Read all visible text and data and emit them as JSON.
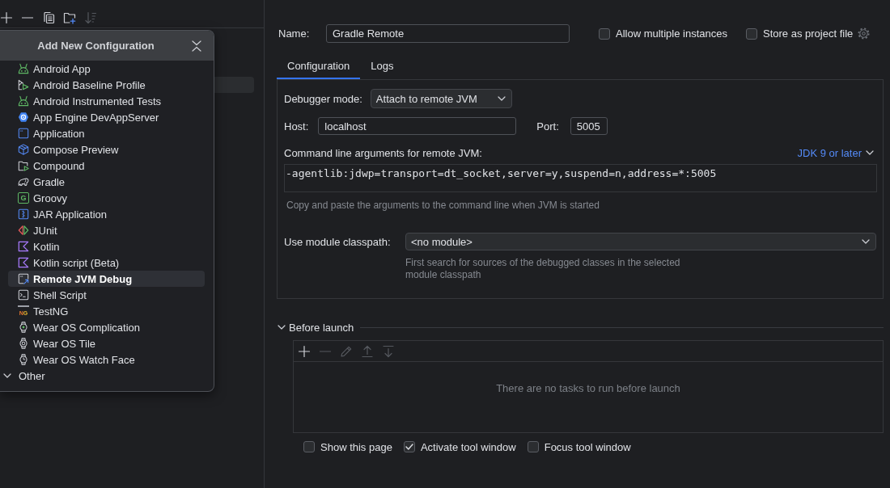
{
  "toolbar": [
    {
      "disabled": false
    },
    {
      "disabled": false
    },
    {
      "disabled": false
    },
    {
      "disabled": false
    },
    {
      "disabled": true
    }
  ],
  "popup": {
    "title": "Add New Configuration",
    "items": [
      {
        "label": "Android App",
        "selected": false
      },
      {
        "label": "Android Baseline Profile",
        "selected": false
      },
      {
        "label": "Android Instrumented Tests",
        "selected": false
      },
      {
        "label": "App Engine DevAppServer",
        "selected": false
      },
      {
        "label": "Application",
        "selected": false
      },
      {
        "label": "Compose Preview",
        "selected": false
      },
      {
        "label": "Compound",
        "selected": false
      },
      {
        "label": "Gradle",
        "selected": false
      },
      {
        "label": "Groovy",
        "icon_text": "G",
        "selected": false
      },
      {
        "label": "JAR Application",
        "selected": false
      },
      {
        "label": "JUnit",
        "selected": false
      },
      {
        "label": "Kotlin",
        "selected": false
      },
      {
        "label": "Kotlin script (Beta)",
        "selected": false
      },
      {
        "label": "Remote JVM Debug",
        "selected": true
      },
      {
        "label": "Shell Script",
        "selected": false
      },
      {
        "label": "TestNG",
        "icon_text": "NG",
        "selected": false
      },
      {
        "label": "Wear OS Complication",
        "selected": false
      },
      {
        "label": "Wear OS Tile",
        "selected": false
      },
      {
        "label": "Wear OS Watch Face",
        "selected": false
      }
    ],
    "other_group": {
      "label": "Other",
      "expanded": true
    }
  },
  "name": {
    "label": "Name:",
    "value": "Gradle Remote"
  },
  "options": [
    {
      "label": "Allow multiple instances",
      "checked": false
    },
    {
      "label": "Store as project file",
      "checked": false
    }
  ],
  "tabs": [
    {
      "label": "Configuration",
      "selected": true
    },
    {
      "label": "Logs",
      "selected": false
    }
  ],
  "configuration": {
    "debugger_mode": {
      "label": "Debugger mode:",
      "value": "Attach to remote JVM"
    },
    "host": {
      "label": "Host:",
      "value": "localhost"
    },
    "port": {
      "label": "Port:",
      "value": "5005"
    },
    "arguments": {
      "label": "Command line arguments for remote JVM:",
      "link": "JDK 9 or later",
      "value": "-agentlib:jdwp=transport=dt_socket,server=y,suspend=n,address=*:5005",
      "hint": "Copy and paste the arguments to the command line when JVM is started"
    },
    "module_classpath": {
      "label": "Use module classpath:",
      "value": "<no module>",
      "hint": "First search for sources of the debugged classes in the selected module classpath"
    }
  },
  "before_launch": {
    "title": "Before launch",
    "expanded": true,
    "toolbar": [
      {
        "disabled": false
      },
      {
        "disabled": true
      },
      {
        "disabled": true
      },
      {
        "disabled": true
      },
      {
        "disabled": true
      }
    ],
    "empty_text": "There are no tasks to run before launch",
    "options": [
      {
        "label": "Show this page",
        "checked": false
      },
      {
        "label": "Activate tool window",
        "checked": true
      },
      {
        "label": "Focus tool window",
        "checked": false
      }
    ]
  }
}
